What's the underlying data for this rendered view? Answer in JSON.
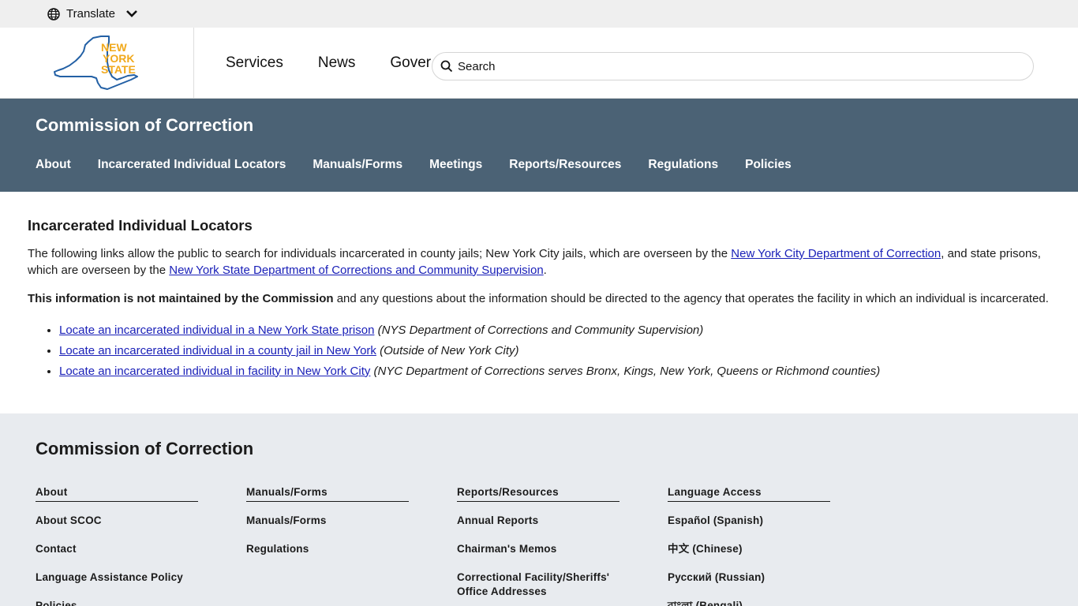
{
  "translate": {
    "label": "Translate"
  },
  "header": {
    "logo_text": [
      "NEW",
      "YORK",
      "STATE"
    ],
    "nav": [
      "Services",
      "News",
      "Government"
    ],
    "search_placeholder": "Search"
  },
  "agency": {
    "title": "Commission of Correction",
    "nav": [
      "About",
      "Incarcerated Individual Locators",
      "Manuals/Forms",
      "Meetings",
      "Reports/Resources",
      "Regulations",
      "Policies"
    ]
  },
  "content": {
    "heading": "Incarcerated Individual Locators",
    "p1_pre": "The following links allow the public to search for individuals incarcerated in county jails; New York City jails, which are overseen by the ",
    "p1_link1": "New York City Department of Correction",
    "p1_mid": ", and state prisons, which are overseen by the ",
    "p1_link2": "New York State Department of Corrections and Community Supervision",
    "p1_end": ".",
    "p2_bold": "This information is not maintained by the Commission",
    "p2_rest": " and any questions about the information should be directed to the agency that operates the facility in which an individual is incarcerated.",
    "links": [
      {
        "link": "Locate an incarcerated individual in a New York State prison",
        "note": " (NYS Department of Corrections and Community Supervision)"
      },
      {
        "link": "Locate an incarcerated individual in a county jail in New York",
        "note": " (Outside of New York City)"
      },
      {
        "link": "Locate an incarcerated individual in facility in New York City",
        "note": " (NYC Department of Corrections serves Bronx, Kings, New York, Queens or Richmond counties)"
      }
    ]
  },
  "footer": {
    "title": "Commission of Correction",
    "columns": [
      {
        "heading": "About",
        "items": [
          "About SCOC",
          "Contact",
          "Language Assistance Policy",
          "Policies"
        ]
      },
      {
        "heading": "Manuals/Forms",
        "items": [
          "Manuals/Forms",
          "Regulations"
        ]
      },
      {
        "heading": "Reports/Resources",
        "items": [
          "Annual Reports",
          "Chairman's Memos",
          "Correctional Facility/Sheriffs' Office Addresses"
        ]
      },
      {
        "heading": "Language Access",
        "items": [
          "Español (Spanish)",
          "中文 (Chinese)",
          "Русский (Russian)",
          "বাংলা (Bengali)"
        ]
      }
    ]
  },
  "colors": {
    "agency_band": "#4b6275",
    "logo_gold": "#f1a91c",
    "logo_blue": "#2360a5",
    "link": "#1a20b8",
    "footer_bg": "#e8ebef"
  }
}
